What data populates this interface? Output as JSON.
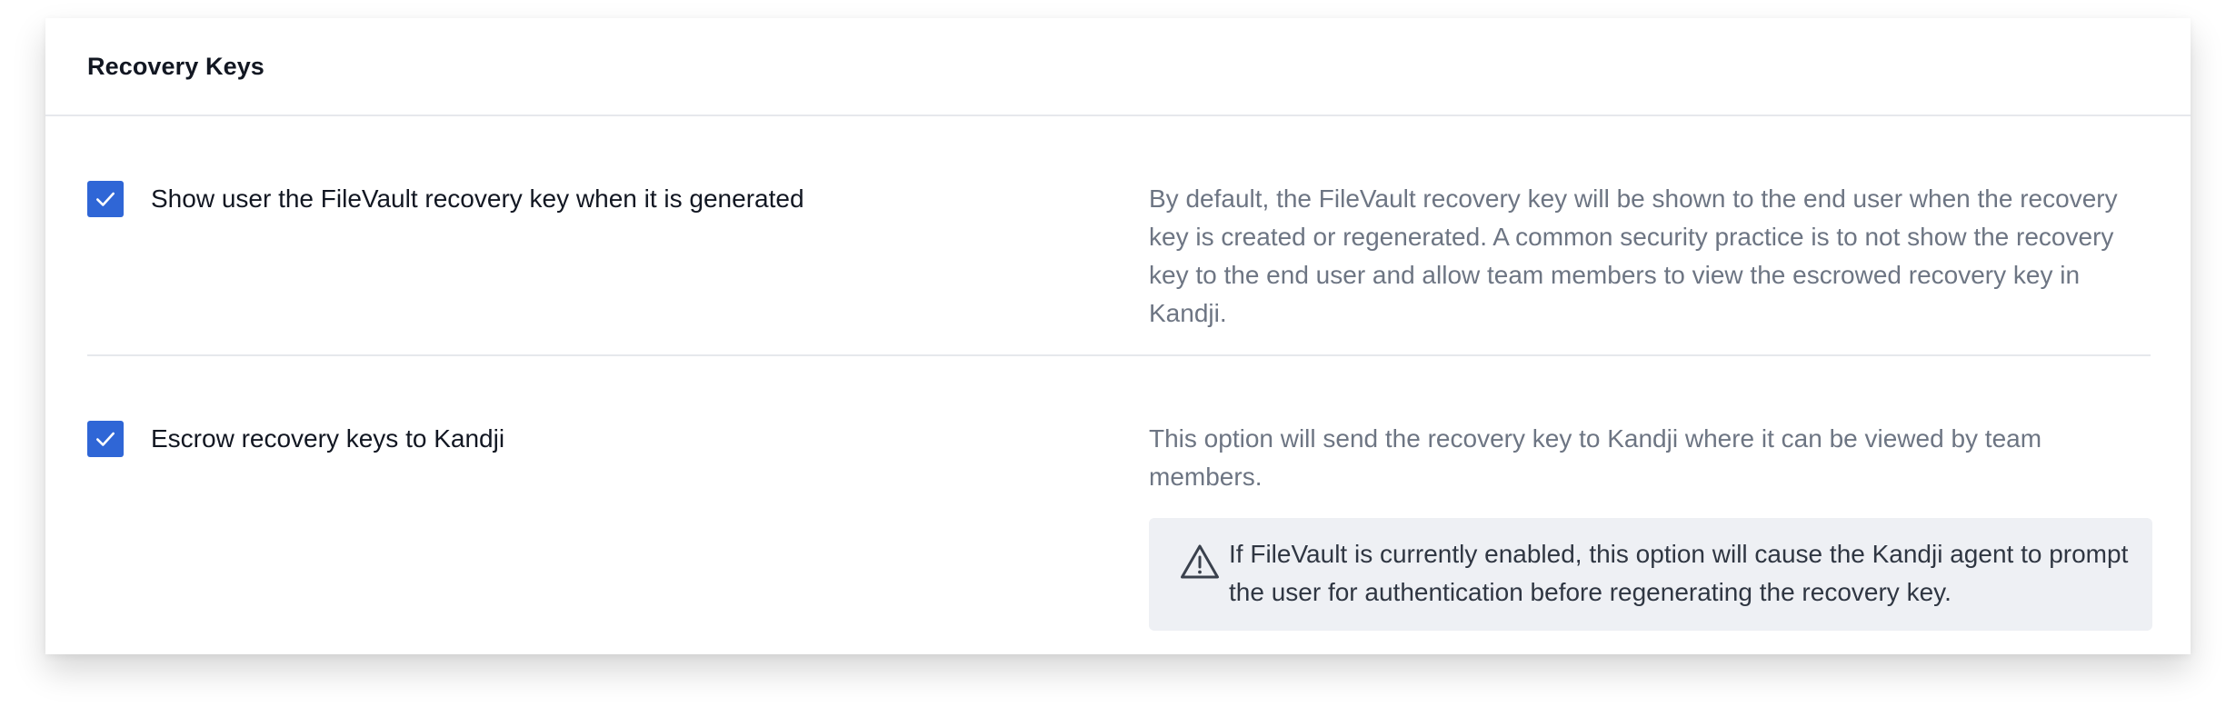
{
  "section": {
    "title": "Recovery Keys"
  },
  "options": [
    {
      "label": "Show user the FileVault recovery key when it is generated",
      "checked": true,
      "description": "By default, the FileVault recovery key will be shown to the end user when the recovery key is created or regenerated. A common security practice is to not show the recovery key to the end user and allow team members to view the escrowed recovery key in Kandji."
    },
    {
      "label": "Escrow recovery keys to Kandji",
      "checked": true,
      "description": "This option will send the recovery key to Kandji where it can be viewed by team members.",
      "warning": "If FileVault is currently enabled, this option will cause the Kandji agent to prompt the user for authentication before regenerating the recovery key."
    }
  ],
  "icons": {
    "checkbox": "checkmark-icon",
    "warning": "warning-triangle-icon"
  },
  "colors": {
    "accent": "#2f66d6",
    "title_text": "#121722",
    "muted_text": "#6d7583",
    "warning_bg": "#eef0f4"
  }
}
